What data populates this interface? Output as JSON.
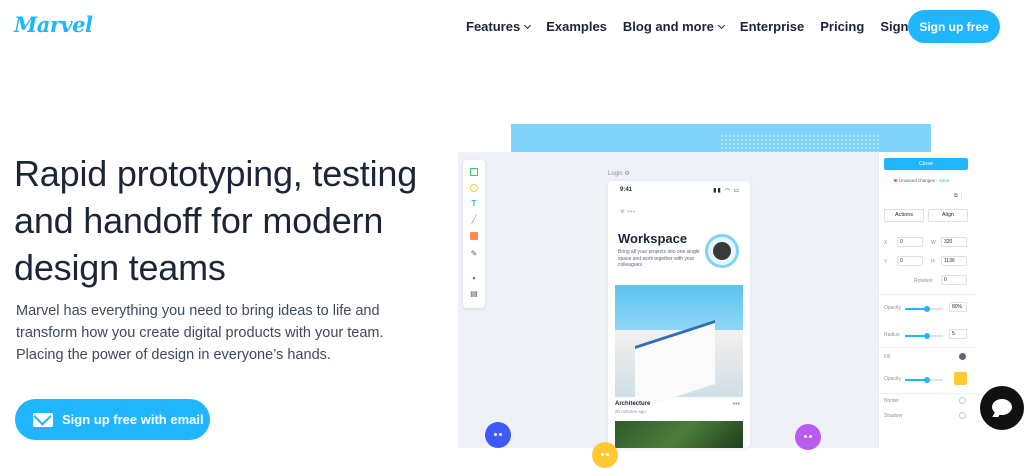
{
  "nav": {
    "logo": "Marvel",
    "links": [
      {
        "label": "Features",
        "dropdown": true
      },
      {
        "label": "Examples",
        "dropdown": false
      },
      {
        "label": "Blog and more",
        "dropdown": true
      },
      {
        "label": "Enterprise",
        "dropdown": false
      },
      {
        "label": "Pricing",
        "dropdown": false
      },
      {
        "label": "Sign in",
        "dropdown": false
      }
    ],
    "signup_label": "Sign up free"
  },
  "hero": {
    "title": "Rapid prototyping, testing and handoff for modern design teams",
    "description": "Marvel has everything you need to bring ideas to life and transform how you create digital products with your team. Placing the power of design in everyone’s hands.",
    "cta_label": "Sign up free with email"
  },
  "mockup": {
    "artboard_label": "Login ⚙",
    "phone": {
      "time": "9:41",
      "status_icons": "▮▮ ◠ ▭",
      "heart": "♥ •••",
      "workspace_title": "Workspace",
      "workspace_desc": "Bring all your projects into one single space and work together with your colleagues.",
      "card_title": "Architecture",
      "card_sub": "20 minutes ago",
      "card_more": "•••"
    },
    "panel": {
      "close_label": "Close",
      "unsaved_text": "Unsaved changes -",
      "save_link": "Save",
      "toolbar_icons": "⧉   ⋮",
      "actions_label": "Actions",
      "align_label": "Align",
      "x_label": "X",
      "x_value": "0",
      "w_label": "W",
      "w_value": "320",
      "y_label": "Y",
      "y_value": "0",
      "h_label": "H",
      "h_value": "1136",
      "rotation_label": "Rotation",
      "rotation_value": "0",
      "opacity_label": "Opacity",
      "opacity_value": "80%",
      "radius_label": "Radius",
      "radius_value": "5",
      "fill_label": "Fill",
      "fill_opacity_label": "Opacity",
      "border_label": "Border",
      "shadow_label": "Shadow"
    }
  },
  "colors": {
    "accent": "#1fb6ff",
    "text": "#1c2537",
    "blob_blue": "#3d5afe",
    "blob_yellow": "#ffc933",
    "blob_purple": "#b85cf0",
    "swatch": "#ffc933"
  },
  "icons": [
    "square-icon",
    "circle-icon",
    "text-icon",
    "line-icon",
    "image-icon",
    "pen-icon",
    "components-icon",
    "layers-icon",
    "mail-icon",
    "chat-icon"
  ]
}
